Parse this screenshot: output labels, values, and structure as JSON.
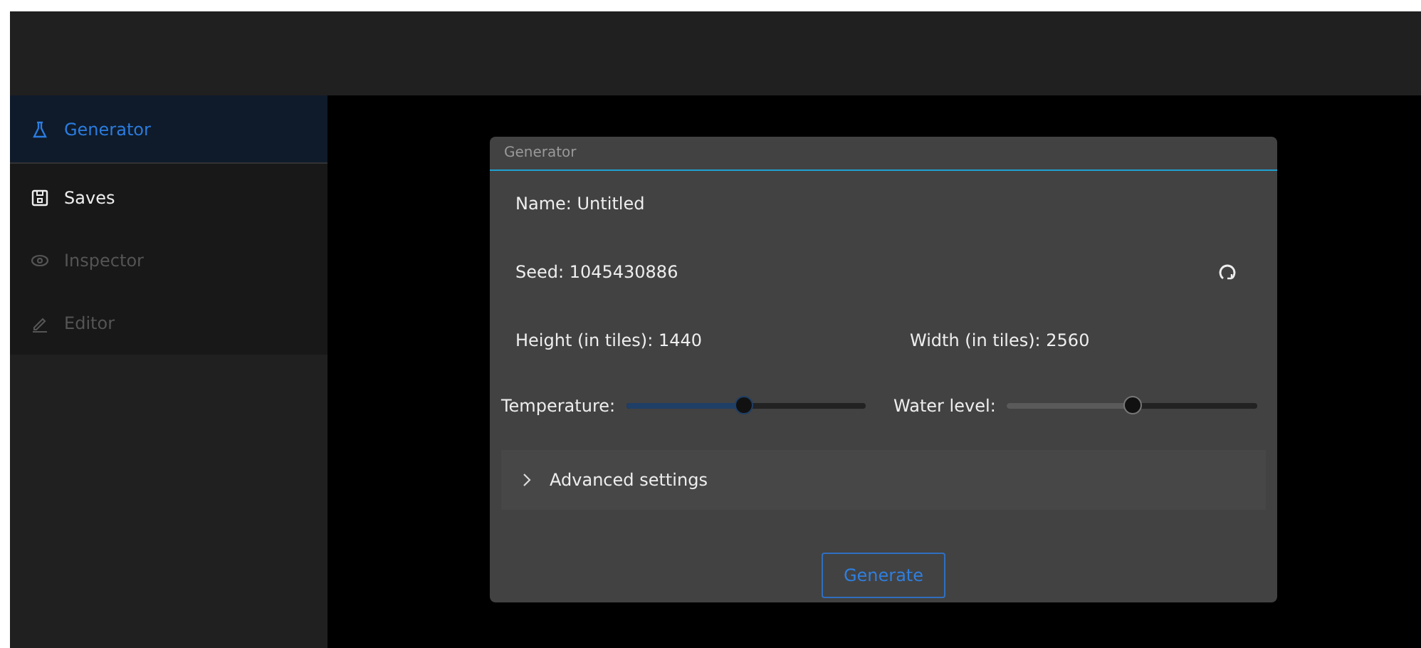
{
  "sidebar": {
    "items": [
      {
        "label": "Generator",
        "kind": "flask",
        "selected": true,
        "disabled": false
      },
      {
        "label": "Saves",
        "kind": "floppy",
        "selected": false,
        "disabled": false
      },
      {
        "label": "Inspector",
        "kind": "eye",
        "selected": false,
        "disabled": true
      },
      {
        "label": "Editor",
        "kind": "pencil",
        "selected": false,
        "disabled": true
      }
    ]
  },
  "dialog": {
    "title": "Generator",
    "name": "Name: Untitled",
    "seed": "Seed: 1045430886",
    "height": "Height (in tiles): 1440",
    "width": "Width (in tiles): 2560",
    "sliders": [
      {
        "label": "Temperature:",
        "level": 0.49,
        "active": true
      },
      {
        "label": "Water level:",
        "level": 0.5,
        "active": false
      }
    ],
    "advanced": {
      "label": "Advanced settings",
      "expanded": false
    },
    "button": "Generate"
  }
}
